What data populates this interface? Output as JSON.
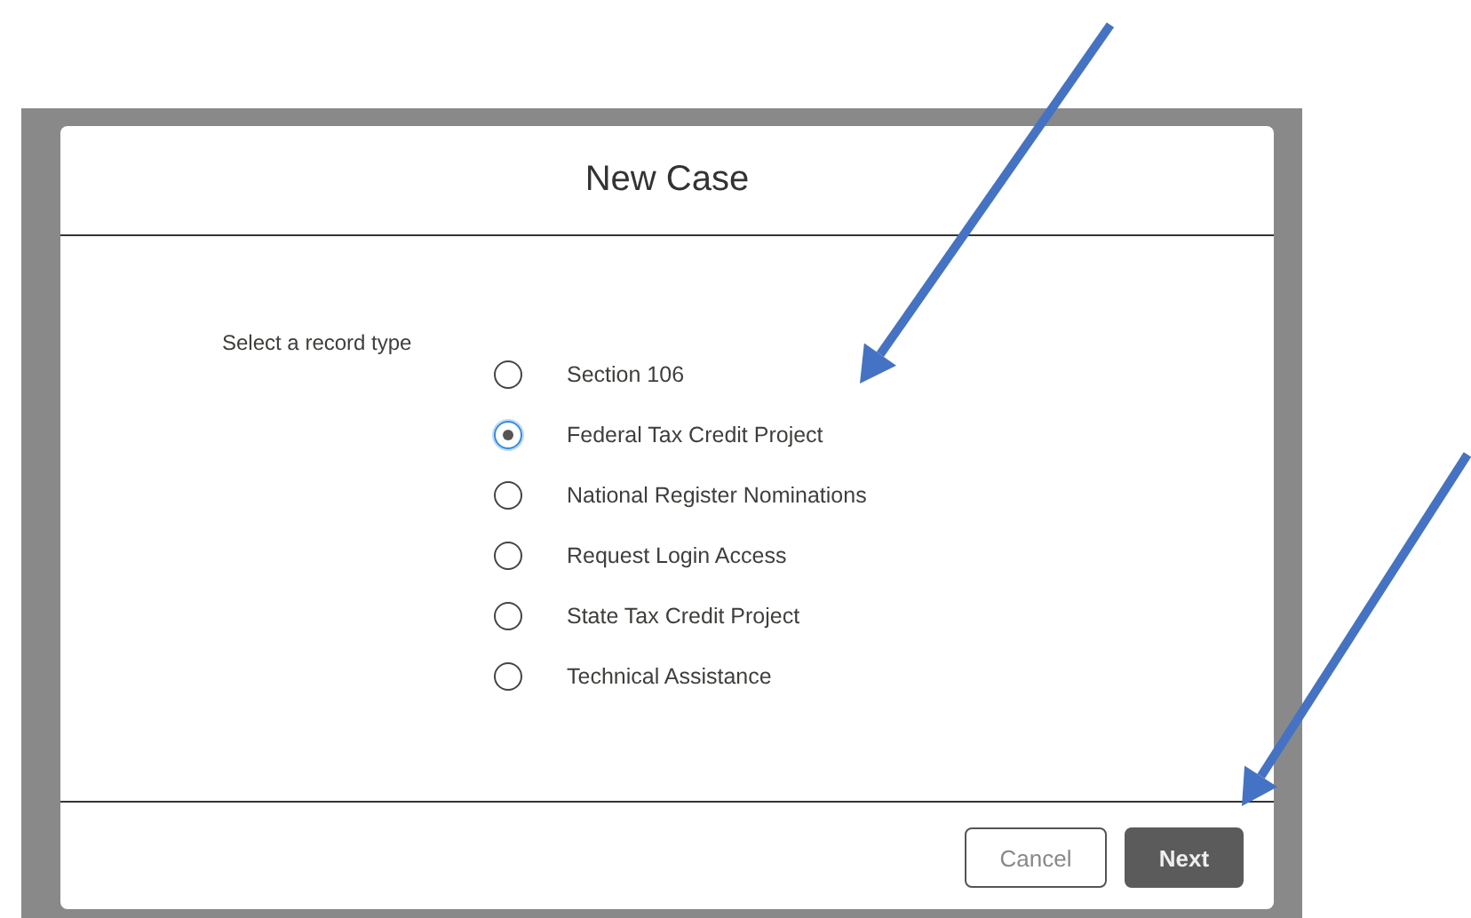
{
  "dialog": {
    "title": "New Case",
    "prompt": "Select a record type",
    "options": [
      {
        "label": "Section 106",
        "selected": false
      },
      {
        "label": "Federal Tax Credit Project",
        "selected": true
      },
      {
        "label": "National Register Nominations",
        "selected": false
      },
      {
        "label": "Request Login Access",
        "selected": false
      },
      {
        "label": "State Tax Credit Project",
        "selected": false
      },
      {
        "label": "Technical Assistance",
        "selected": false
      }
    ],
    "buttons": [
      {
        "label": "Cancel",
        "kind": "secondary"
      },
      {
        "label": "Next",
        "kind": "primary"
      }
    ]
  }
}
